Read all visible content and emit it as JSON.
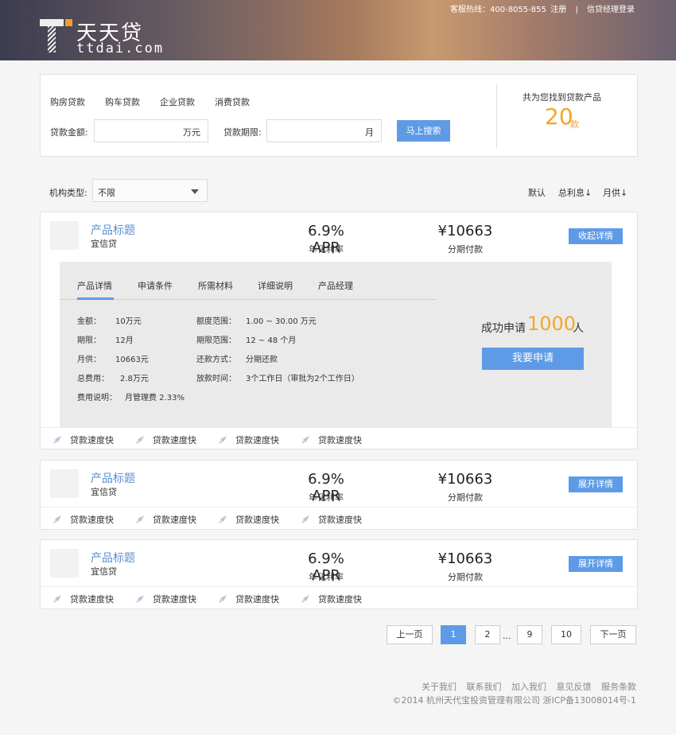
{
  "header": {
    "logo_cn": "天天贷",
    "logo_en": "ttdai.com",
    "hotline": "客服热线：400-8055-855",
    "register": "注册",
    "separator": "|",
    "manager_login": "信贷经理登录"
  },
  "search": {
    "loan_types": [
      "购房贷款",
      "购车贷款",
      "企业贷款",
      "消费贷款"
    ],
    "amount_label": "贷款金额:",
    "amount_unit": "万元",
    "amount_value": "",
    "term_label": "贷款期限:",
    "term_unit": "月",
    "term_value": "",
    "button": "马上搜索",
    "found_text": "共为您找到贷款产品",
    "found_count": "20",
    "found_unit": "款"
  },
  "filter": {
    "org_label": "机构类型:",
    "org_value": "不限",
    "sort_default": "默认",
    "sort_interest": "总利息↓",
    "sort_monthly": "月供↓"
  },
  "products": [
    {
      "title": "产品标题",
      "subtitle": "宜信贷",
      "rate": "6.9% APR",
      "rate_label": "年化利率",
      "payment": "¥10663",
      "payment_label": "分期付款",
      "button": "收起详情",
      "features": [
        "贷款速度快",
        "贷款速度快",
        "贷款速度快",
        "贷款速度快"
      ]
    },
    {
      "title": "产品标题",
      "subtitle": "宜信贷",
      "rate": "6.9% APR",
      "rate_label": "年化利率",
      "payment": "¥10663",
      "payment_label": "分期付款",
      "button": "展开详情",
      "features": [
        "贷款速度快",
        "贷款速度快",
        "贷款速度快",
        "贷款速度快"
      ]
    },
    {
      "title": "产品标题",
      "subtitle": "宜信贷",
      "rate": "6.9% APR",
      "rate_label": "年化利率",
      "payment": "¥10663",
      "payment_label": "分期付款",
      "button": "展开详情",
      "features": [
        "贷款速度快",
        "贷款速度快",
        "贷款速度快",
        "贷款速度快"
      ]
    }
  ],
  "details": {
    "tabs": [
      "产品详情",
      "申请条件",
      "所需材料",
      "详细说明",
      "产品经理"
    ],
    "left": [
      {
        "k": "金额：",
        "v": "10万元"
      },
      {
        "k": "期限：",
        "v": "12月"
      },
      {
        "k": "月供：",
        "v": "10663元"
      },
      {
        "k": "总费用：",
        "v": "2.8万元"
      },
      {
        "k": "费用说明：",
        "v": "月管理费 2.33%"
      }
    ],
    "right": [
      {
        "k": "额度范围：",
        "v": "1.00 ~ 30.00 万元"
      },
      {
        "k": "期限范围：",
        "v": "12 ~ 48 个月"
      },
      {
        "k": "还款方式：",
        "v": "分期还款"
      },
      {
        "k": "放款时间：",
        "v": "3个工作日（审批为2个工作日）"
      }
    ],
    "apply_text": "成功申请",
    "apply_count": "1000",
    "apply_unit": "人",
    "apply_button": "我要申请"
  },
  "pagination": {
    "prev": "上一页",
    "pages": [
      "1",
      "2",
      "9",
      "10"
    ],
    "dots": "...",
    "next": "下一页"
  },
  "footer": {
    "links": [
      "关于我们",
      "联系我们",
      "加入我们",
      "意见反馈",
      "服务条款"
    ],
    "copyright": "©2014 杭州天代宝投资管理有限公司 浙ICP备13008014号-1"
  },
  "colors": {
    "accent": "#5e9be6",
    "highlight": "#f5a623"
  }
}
